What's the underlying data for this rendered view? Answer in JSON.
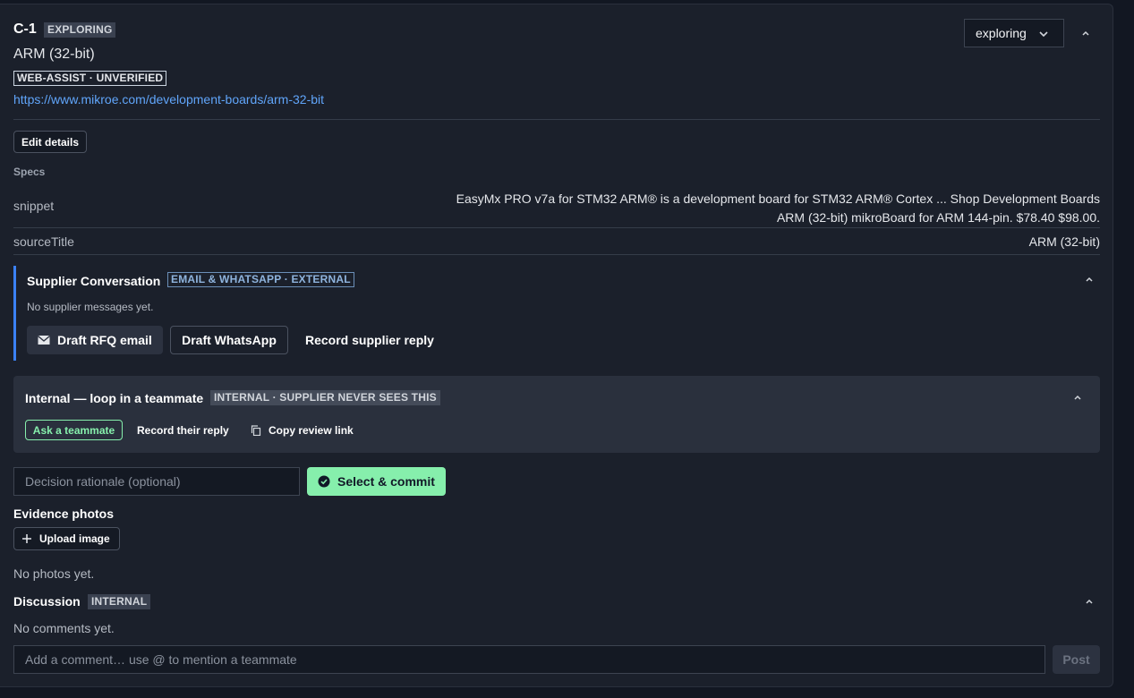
{
  "candidate": {
    "id": "C-1",
    "status_badge": "EXPLORING",
    "name": "ARM (32-bit)",
    "source_badge": "WEB-ASSIST · UNVERIFIED",
    "url": "https://www.mikroe.com/development-boards/arm-32-bit",
    "status_select": "exploring"
  },
  "edit_label": "Edit details",
  "specs": {
    "heading": "Specs",
    "rows": [
      {
        "key": "snippet",
        "line1": "EasyMx PRO v7a for STM32 ARM® is a development board for STM32 ARM® Cortex ... Shop Development Boards",
        "line2": "ARM (32-bit) mikroBoard for ARM 144-pin. $78.40 $98.00."
      },
      {
        "key": "sourceTitle",
        "value": "ARM (32-bit)"
      }
    ]
  },
  "supplier": {
    "title": "Supplier Conversation",
    "badge": "EMAIL & WHATSAPP · EXTERNAL",
    "empty": "No supplier messages yet.",
    "rfq_label": "Draft RFQ email",
    "whatsapp_label": "Draft WhatsApp",
    "record_label": "Record supplier reply"
  },
  "internal": {
    "title": "Internal — loop in a teammate",
    "badge": "INTERNAL · SUPPLIER NEVER SEES THIS",
    "ask_label": "Ask a teammate",
    "record_label": "Record their reply",
    "copy_label": "Copy review link"
  },
  "decision": {
    "placeholder": "Decision rationale (optional)",
    "commit_label": "Select & commit"
  },
  "evidence": {
    "heading": "Evidence photos",
    "upload_label": "Upload image",
    "empty": "No photos yet."
  },
  "discussion": {
    "title": "Discussion",
    "badge": "INTERNAL",
    "empty": "No comments yet.",
    "placeholder": "Add a comment… use @ to mention a teammate",
    "post_label": "Post"
  },
  "colors": {
    "accent_blue": "#3b82f6",
    "link": "#60a5fa",
    "commit_green": "#86efac"
  }
}
